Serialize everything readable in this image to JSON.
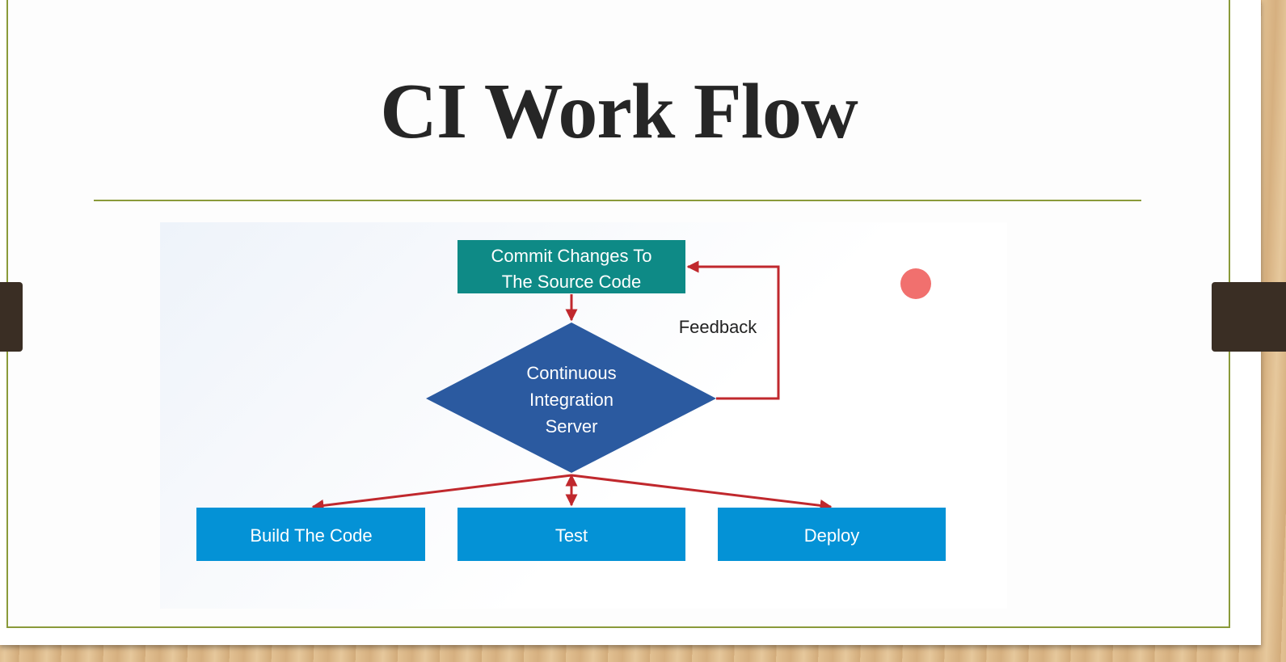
{
  "slide": {
    "title": "CI Work Flow"
  },
  "diagram": {
    "nodes": {
      "commit": {
        "lines": [
          "Commit Changes To",
          "The Source Code"
        ],
        "color": "#0e8a86"
      },
      "ci_server": {
        "lines": [
          "Continuous",
          "Integration",
          "Server"
        ],
        "color": "#2b5aa0"
      },
      "build": {
        "label": "Build The Code",
        "color": "#0492d6"
      },
      "test": {
        "label": "Test",
        "color": "#0492d6"
      },
      "deploy": {
        "label": "Deploy",
        "color": "#0492d6"
      }
    },
    "edges": {
      "feedback_label": "Feedback",
      "color": "#c0282d"
    }
  },
  "colors": {
    "frame_border": "#8a9a3a",
    "pointer_dot": "#f0605e"
  }
}
